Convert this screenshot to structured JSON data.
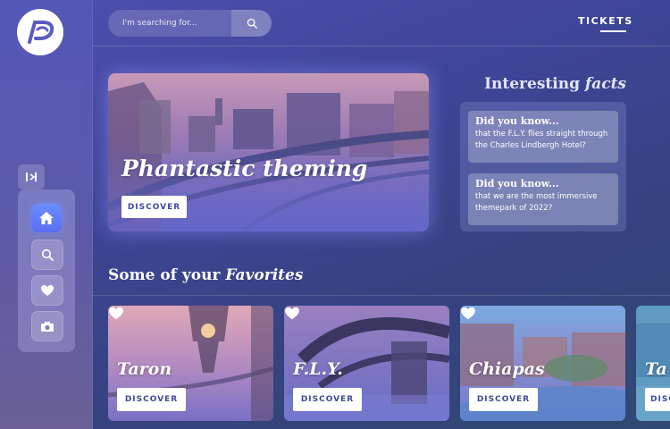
{
  "brand": {
    "logo": "phantasialand-logo"
  },
  "search": {
    "placeholder": "I'm searching for...",
    "icon": "search-icon"
  },
  "header": {
    "tickets_label": "TICKETS"
  },
  "sidebar": {
    "collapse_icon": "sidebar-collapse-icon",
    "items": [
      {
        "icon": "home-icon",
        "active": true
      },
      {
        "icon": "search-icon",
        "active": false
      },
      {
        "icon": "heart-icon",
        "active": false
      },
      {
        "icon": "camera-icon",
        "active": false
      }
    ]
  },
  "hero": {
    "title": "Phantastic theming",
    "button": "DISCOVER"
  },
  "facts": {
    "title_main": "Interesting ",
    "title_italic": "facts",
    "items": [
      {
        "head": "Did you know...",
        "text": "that the F.L.Y. flies straight through the Charles Lindbergh Hotel?"
      },
      {
        "head": "Did you know...",
        "text": "that we are the most immersive themepark of 2022?"
      }
    ]
  },
  "favorites": {
    "title_main": "Some of your ",
    "title_italic": "Favorites",
    "cards": [
      {
        "title": "Taron",
        "button": "DISCOVER"
      },
      {
        "title": "F.L.Y.",
        "button": "DISCOVER"
      },
      {
        "title": "Chiapas",
        "button": "DISCOVER"
      },
      {
        "title": "Ta",
        "button": "DISCOVER"
      }
    ]
  },
  "colors": {
    "accent": "#5a6ef0",
    "button_text": "#3d4a9a",
    "background": "#3f4597"
  }
}
